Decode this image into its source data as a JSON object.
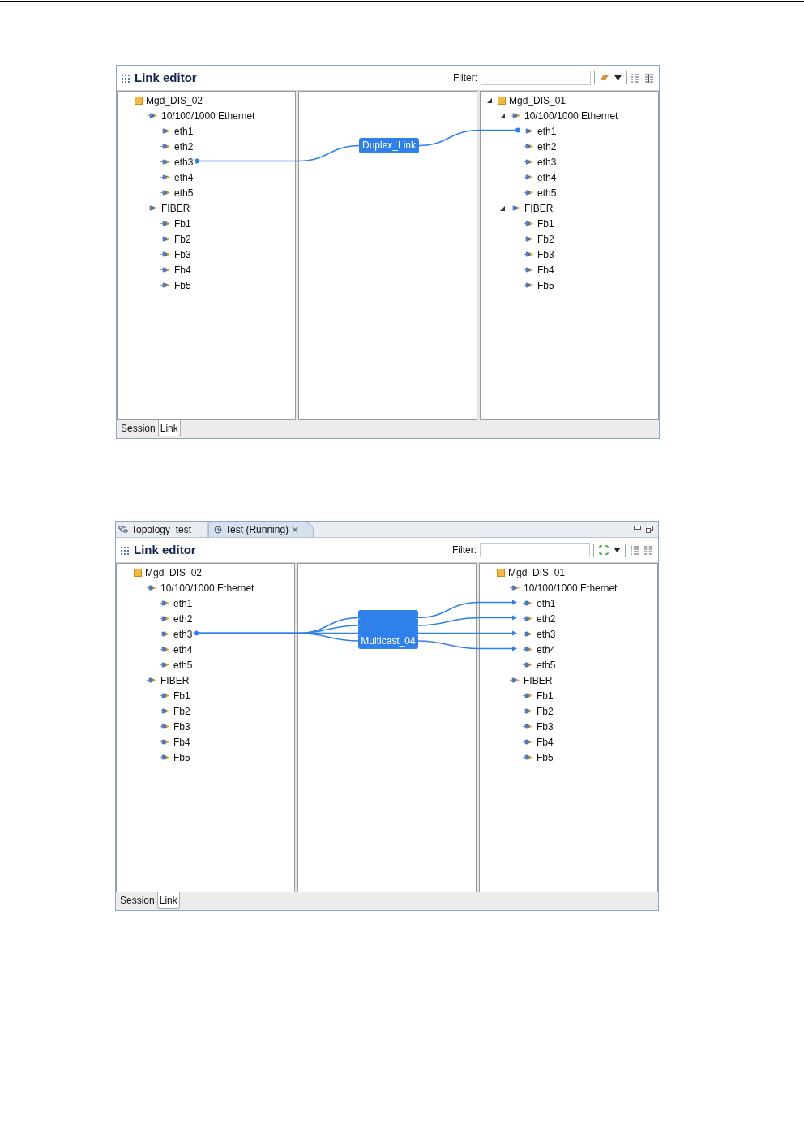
{
  "figures": [
    {
      "kind": "standalone",
      "editor": {
        "title": "Link editor",
        "filter": {
          "label": "Filter:"
        },
        "left_tree": [
          {
            "label": "Mgd_DIS_02",
            "kind": "device",
            "children": [
              {
                "label": "10/100/1000 Ethernet",
                "kind": "port",
                "children": [
                  {
                    "label": "eth1",
                    "kind": "port"
                  },
                  {
                    "label": "eth2",
                    "kind": "port"
                  },
                  {
                    "label": "eth3",
                    "kind": "port",
                    "linked": true
                  },
                  {
                    "label": "eth4",
                    "kind": "port"
                  },
                  {
                    "label": "eth5",
                    "kind": "port"
                  }
                ]
              },
              {
                "label": "FIBER",
                "kind": "port",
                "children": [
                  {
                    "label": "Fb1",
                    "kind": "port"
                  },
                  {
                    "label": "Fb2",
                    "kind": "port"
                  },
                  {
                    "label": "Fb3",
                    "kind": "port"
                  },
                  {
                    "label": "Fb4",
                    "kind": "port"
                  },
                  {
                    "label": "Fb5",
                    "kind": "port"
                  }
                ]
              }
            ]
          }
        ],
        "right_tree": [
          {
            "label": "Mgd_DIS_01",
            "kind": "device",
            "expanded": true,
            "children": [
              {
                "label": "10/100/1000 Ethernet",
                "kind": "port",
                "expanded": true,
                "children": [
                  {
                    "label": "eth1",
                    "kind": "port",
                    "linked": true
                  },
                  {
                    "label": "eth2",
                    "kind": "port"
                  },
                  {
                    "label": "eth3",
                    "kind": "port"
                  },
                  {
                    "label": "eth4",
                    "kind": "port"
                  },
                  {
                    "label": "eth5",
                    "kind": "port"
                  }
                ]
              },
              {
                "label": "FIBER",
                "kind": "port",
                "expanded": true,
                "children": [
                  {
                    "label": "Fb1",
                    "kind": "port"
                  },
                  {
                    "label": "Fb2",
                    "kind": "port"
                  },
                  {
                    "label": "Fb3",
                    "kind": "port"
                  },
                  {
                    "label": "Fb4",
                    "kind": "port"
                  },
                  {
                    "label": "Fb5",
                    "kind": "port"
                  }
                ]
              }
            ]
          }
        ],
        "links": [
          {
            "label": "Duplex_Link",
            "kind": "duplex"
          }
        ],
        "bottom_tabs": [
          {
            "label": "Session",
            "selected": false
          },
          {
            "label": "Link",
            "selected": true
          }
        ]
      }
    },
    {
      "kind": "tabbed",
      "top_tabs": [
        {
          "label": "Topology_test",
          "kind": "topology",
          "selected": false,
          "closable": false
        },
        {
          "label": "Test (Running)",
          "kind": "test",
          "selected": true,
          "closable": true
        }
      ],
      "editor": {
        "title": "Link editor",
        "filter": {
          "label": "Filter:"
        },
        "left_tree": [
          {
            "label": "Mgd_DIS_02",
            "kind": "device",
            "children": [
              {
                "label": "10/100/1000 Ethernet",
                "kind": "port",
                "children": [
                  {
                    "label": "eth1",
                    "kind": "port"
                  },
                  {
                    "label": "eth2",
                    "kind": "port"
                  },
                  {
                    "label": "eth3",
                    "kind": "port",
                    "linked": true
                  },
                  {
                    "label": "eth4",
                    "kind": "port"
                  },
                  {
                    "label": "eth5",
                    "kind": "port"
                  }
                ]
              },
              {
                "label": "FIBER",
                "kind": "port",
                "children": [
                  {
                    "label": "Fb1",
                    "kind": "port"
                  },
                  {
                    "label": "Fb2",
                    "kind": "port"
                  },
                  {
                    "label": "Fb3",
                    "kind": "port"
                  },
                  {
                    "label": "Fb4",
                    "kind": "port"
                  },
                  {
                    "label": "Fb5",
                    "kind": "port"
                  }
                ]
              }
            ]
          }
        ],
        "right_tree": [
          {
            "label": "Mgd_DIS_01",
            "kind": "device",
            "children": [
              {
                "label": "10/100/1000 Ethernet",
                "kind": "port",
                "children": [
                  {
                    "label": "eth1",
                    "kind": "port",
                    "linked": true
                  },
                  {
                    "label": "eth2",
                    "kind": "port",
                    "linked": true
                  },
                  {
                    "label": "eth3",
                    "kind": "port",
                    "linked": true
                  },
                  {
                    "label": "eth4",
                    "kind": "port",
                    "linked": true
                  },
                  {
                    "label": "eth5",
                    "kind": "port"
                  }
                ]
              },
              {
                "label": "FIBER",
                "kind": "port",
                "children": [
                  {
                    "label": "Fb1",
                    "kind": "port"
                  },
                  {
                    "label": "Fb2",
                    "kind": "port"
                  },
                  {
                    "label": "Fb3",
                    "kind": "port"
                  },
                  {
                    "label": "Fb4",
                    "kind": "port"
                  },
                  {
                    "label": "Fb5",
                    "kind": "port"
                  }
                ]
              }
            ]
          }
        ],
        "links": [
          {
            "kind": "multicast"
          },
          {
            "kind": "multicast"
          },
          {
            "kind": "multicast"
          },
          {
            "label": "Multicast_04",
            "kind": "multicast"
          }
        ],
        "bottom_tabs": [
          {
            "label": "Session",
            "selected": false
          },
          {
            "label": "Link",
            "selected": true
          }
        ]
      }
    }
  ]
}
